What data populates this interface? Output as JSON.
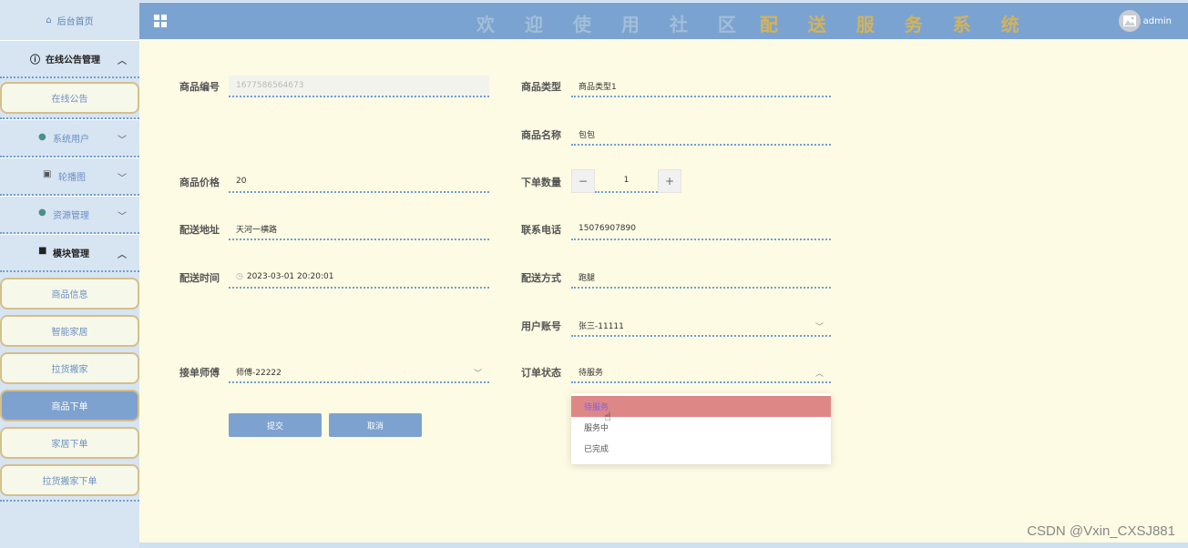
{
  "sidebar": {
    "home": "后台首页",
    "groups": [
      {
        "label": "在线公告管理",
        "expanded": true,
        "icon": "info-icon",
        "items": [
          "在线公告"
        ]
      },
      {
        "label": "系统用户",
        "expanded": false,
        "icon": "user-icon"
      },
      {
        "label": "轮播图",
        "expanded": false,
        "icon": "image-icon"
      },
      {
        "label": "资源管理",
        "expanded": false,
        "icon": "bulb-icon"
      },
      {
        "label": "模块管理",
        "expanded": true,
        "icon": "grid-icon",
        "items": [
          "商品信息",
          "智能家居",
          "拉货搬家",
          "商品下单",
          "家居下单",
          "拉货搬家下单"
        ]
      }
    ],
    "active_item": "商品下单"
  },
  "header": {
    "title_part1": "欢 迎 使 用 社 区",
    "title_part2": "配 送 服 务 系 统",
    "user": "admin",
    "accent": "#7ba3d1"
  },
  "form": {
    "product_no_label": "商品编号",
    "product_no": "1677586564673",
    "product_type_label": "商品类型",
    "product_type": "商品类型1",
    "product_name_label": "商品名称",
    "product_name": "包包",
    "price_label": "商品价格",
    "price": "20",
    "quantity_label": "下单数量",
    "quantity": "1",
    "address_label": "配送地址",
    "address": "天河一横路",
    "phone_label": "联系电话",
    "phone": "15076907890",
    "time_label": "配送时间",
    "time": "2023-03-01 20:20:01",
    "method_label": "配送方式",
    "method": "跑腿",
    "account_label": "用户账号",
    "account": "张三-11111",
    "worker_label": "接单师傅",
    "worker": "师傅-22222",
    "status_label": "订单状态",
    "status": "待服务",
    "submit": "提交",
    "cancel": "取消"
  },
  "status_options": [
    "待服务",
    "服务中",
    "已完成"
  ],
  "watermark": "CSDN @Vxin_CXSJ881"
}
